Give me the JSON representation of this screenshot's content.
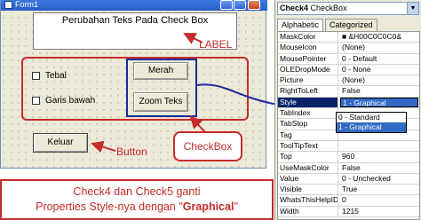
{
  "form": {
    "title": "Form1",
    "label_text": "Perubahan Teks Pada Check Box",
    "checkboxes": [
      {
        "label": "Tebal",
        "checked": false
      },
      {
        "label": "Garis bawah",
        "checked": false
      }
    ],
    "graphical_buttons": [
      "Merah",
      "Zoom Teks"
    ],
    "exit_button": "Keluar"
  },
  "callouts": {
    "label": "LABEL",
    "button": "Button",
    "checkbox": "CheckBox"
  },
  "caption": {
    "line1": "Check4 dan Check5 ganti",
    "line2_prefix": "Properties Style-nya dengan \"",
    "line2_emphasis": "Graphical",
    "line2_suffix": "\""
  },
  "properties": {
    "object_name": "Check4",
    "object_type": "CheckBox",
    "tabs": [
      "Alphabetic",
      "Categorized"
    ],
    "rows": [
      {
        "name": "MaskColor",
        "value": "■ &H00C0C0C0&"
      },
      {
        "name": "MouseIcon",
        "value": "(None)"
      },
      {
        "name": "MousePointer",
        "value": "0 - Default"
      },
      {
        "name": "OLEDropMode",
        "value": "0 - None"
      },
      {
        "name": "Picture",
        "value": "(None)"
      },
      {
        "name": "RightToLeft",
        "value": "False"
      },
      {
        "name": "Style",
        "value": "1 - Graphical",
        "selected": true
      },
      {
        "name": "TabIndex",
        "value": ""
      },
      {
        "name": "TabStop",
        "value": ""
      },
      {
        "name": "Tag",
        "value": ""
      },
      {
        "name": "ToolTipText",
        "value": ""
      },
      {
        "name": "Top",
        "value": "960"
      },
      {
        "name": "UseMaskColor",
        "value": "False"
      },
      {
        "name": "Value",
        "value": "0 - Unchecked"
      },
      {
        "name": "Visible",
        "value": "True"
      },
      {
        "name": "WhatsThisHelpID",
        "value": "0"
      },
      {
        "name": "Width",
        "value": "1215"
      }
    ],
    "style_options": [
      "0 - Standard",
      "1 - Graphical"
    ],
    "style_selected_option": "1 - Graphical"
  },
  "colors": {
    "accent_red": "#c72b2b",
    "accent_blue": "#1c2a9a",
    "selection": "#316ac5"
  }
}
